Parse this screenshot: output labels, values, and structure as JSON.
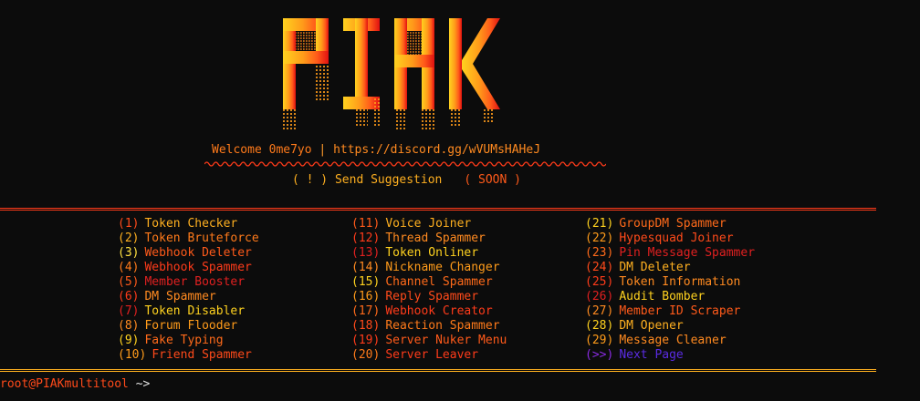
{
  "logo": {
    "text": "PIAK",
    "colors": [
      "#ffd21f",
      "#ff9b1a",
      "#ff5a1a",
      "#e01010"
    ]
  },
  "banner": {
    "welcome_label": "Welcome 0me7yo",
    "separator": "|",
    "invite": "https://discord.gg/wVUMsHAHeJ"
  },
  "suggestion": {
    "label": "( ! ) Send Suggestion",
    "status": "( SOON )"
  },
  "menu": {
    "column1": [
      {
        "num": "(1)",
        "label": "Token Checker",
        "num_color": "#ff4a1a",
        "label_color": "#ffb020"
      },
      {
        "num": "(2)",
        "label": "Token Bruteforce",
        "num_color": "#ffb020",
        "label_color": "#ff7a1a"
      },
      {
        "num": "(3)",
        "label": "Webhook Deleter",
        "num_color": "#ffe040",
        "label_color": "#ff5a1a"
      },
      {
        "num": "(4)",
        "label": "Webhook Spammer",
        "num_color": "#ff7a1a",
        "label_color": "#ff3b1a"
      },
      {
        "num": "(5)",
        "label": "Member Booster",
        "num_color": "#ff5a1a",
        "label_color": "#e02020"
      },
      {
        "num": "(6)",
        "label": "DM Spammer",
        "num_color": "#ff3b1a",
        "label_color": "#ff8a20"
      },
      {
        "num": "(7)",
        "label": "Token Disabler",
        "num_color": "#e02020",
        "label_color": "#ffd21f"
      },
      {
        "num": "(8)",
        "label": "Forum Flooder",
        "num_color": "#ff8a20",
        "label_color": "#ff9b1a"
      },
      {
        "num": "(9)",
        "label": "Fake Typing",
        "num_color": "#ffd21f",
        "label_color": "#ff6a1a"
      },
      {
        "num": "(10)",
        "label": "Friend Spammer",
        "num_color": "#ff9b1a",
        "label_color": "#ff4a1a"
      }
    ],
    "column2": [
      {
        "num": "(11)",
        "label": "Voice Joiner",
        "num_color": "#ff5a1a",
        "label_color": "#ffb020"
      },
      {
        "num": "(12)",
        "label": "Thread Spammer",
        "num_color": "#ff3b1a",
        "label_color": "#ff8a20"
      },
      {
        "num": "(13)",
        "label": "Token Onliner",
        "num_color": "#e02020",
        "label_color": "#ffd21f"
      },
      {
        "num": "(14)",
        "label": "Nickname Changer",
        "num_color": "#ff8a20",
        "label_color": "#ff9b1a"
      },
      {
        "num": "(15)",
        "label": "Channel Spammer",
        "num_color": "#ffd21f",
        "label_color": "#ff6a1a"
      },
      {
        "num": "(16)",
        "label": "Reply Spammer",
        "num_color": "#ff9b1a",
        "label_color": "#ff4a1a"
      },
      {
        "num": "(17)",
        "label": "Webhook Creator",
        "num_color": "#ff6a1a",
        "label_color": "#ff3b1a"
      },
      {
        "num": "(18)",
        "label": "Reaction Spammer",
        "num_color": "#ff4a1a",
        "label_color": "#ff7a1a"
      },
      {
        "num": "(19)",
        "label": "Server Nuker Menu",
        "num_color": "#ff3b1a",
        "label_color": "#ff5a1a"
      },
      {
        "num": "(20)",
        "label": "Server Leaver",
        "num_color": "#ff7a1a",
        "label_color": "#ff3b1a"
      }
    ],
    "column3": [
      {
        "num": "(21)",
        "label": "GroupDM Spammer",
        "num_color": "#ffd21f",
        "label_color": "#ff6a1a"
      },
      {
        "num": "(22)",
        "label": "Hypesquad Joiner",
        "num_color": "#ff9b1a",
        "label_color": "#ff4a1a"
      },
      {
        "num": "(23)",
        "label": "Pin Message Spammer",
        "num_color": "#ff6a1a",
        "label_color": "#e02020"
      },
      {
        "num": "(24)",
        "label": "DM Deleter",
        "num_color": "#ff4a1a",
        "label_color": "#ffb020"
      },
      {
        "num": "(25)",
        "label": "Token Information",
        "num_color": "#ff3b1a",
        "label_color": "#ff8a20"
      },
      {
        "num": "(26)",
        "label": "Audit Bomber",
        "num_color": "#e02020",
        "label_color": "#ffd21f"
      },
      {
        "num": "(27)",
        "label": "Member ID Scraper",
        "num_color": "#ff8a20",
        "label_color": "#ff5a1a"
      },
      {
        "num": "(28)",
        "label": "DM Opener",
        "num_color": "#ffd21f",
        "label_color": "#ffb020"
      },
      {
        "num": "(29)",
        "label": "Message Cleaner",
        "num_color": "#ff9b1a",
        "label_color": "#ff8a20"
      },
      {
        "num": "(>>)",
        "label": "Next Page",
        "num_color": "#8a2be2",
        "label_color": "#5a2be2"
      }
    ]
  },
  "prompt": {
    "text": "root@PIAKmultitool",
    "caret": " ~>"
  }
}
